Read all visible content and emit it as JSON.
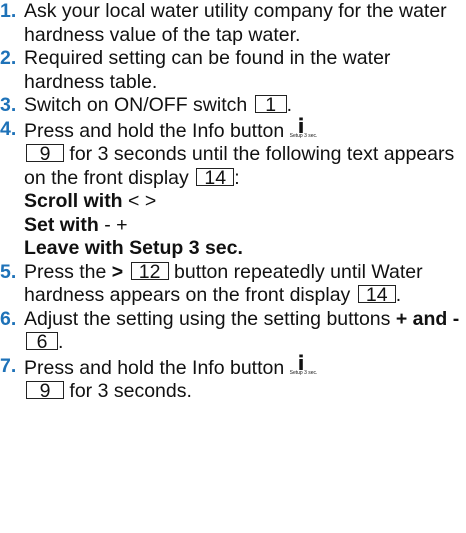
{
  "steps": [
    {
      "num": "1.",
      "text": "Ask your local water utility company for the water hardness value of the tap water."
    },
    {
      "num": "2.",
      "text": "Required setting can be found in the water hardness table."
    },
    {
      "num": "3.",
      "text_a": "Switch on ON/OFF switch",
      "ref": "1",
      "text_b": "."
    },
    {
      "num": "4.",
      "text_a": "Press and hold the Info button",
      "ref": "9",
      "text_b": "for 3 seconds until the following text appears on the front display",
      "ref2": "14",
      "text_c": ":"
    },
    {
      "num": "5.",
      "text_a": "Press the",
      "symbol": ">",
      "ref": "12",
      "text_b": "button repeatedly until Water hardness appears on the front display",
      "ref2": "14",
      "text_c": "."
    },
    {
      "num": "6.",
      "text_a": "Adjust the setting using the setting buttons",
      "bold": "+ and -",
      "ref": "6",
      "text_b": "."
    },
    {
      "num": "7.",
      "text_a": "Press and hold the Info button",
      "ref": "9",
      "text_b": "for 3 seconds."
    }
  ],
  "display_text": {
    "scroll_label": "Scroll with",
    "scroll_keys": "< >",
    "set_label": "Set with",
    "set_keys": "- +",
    "leave": "Leave with Setup 3 sec."
  },
  "info_icon": {
    "glyph": "i",
    "caption": "Setup 3 sec."
  }
}
